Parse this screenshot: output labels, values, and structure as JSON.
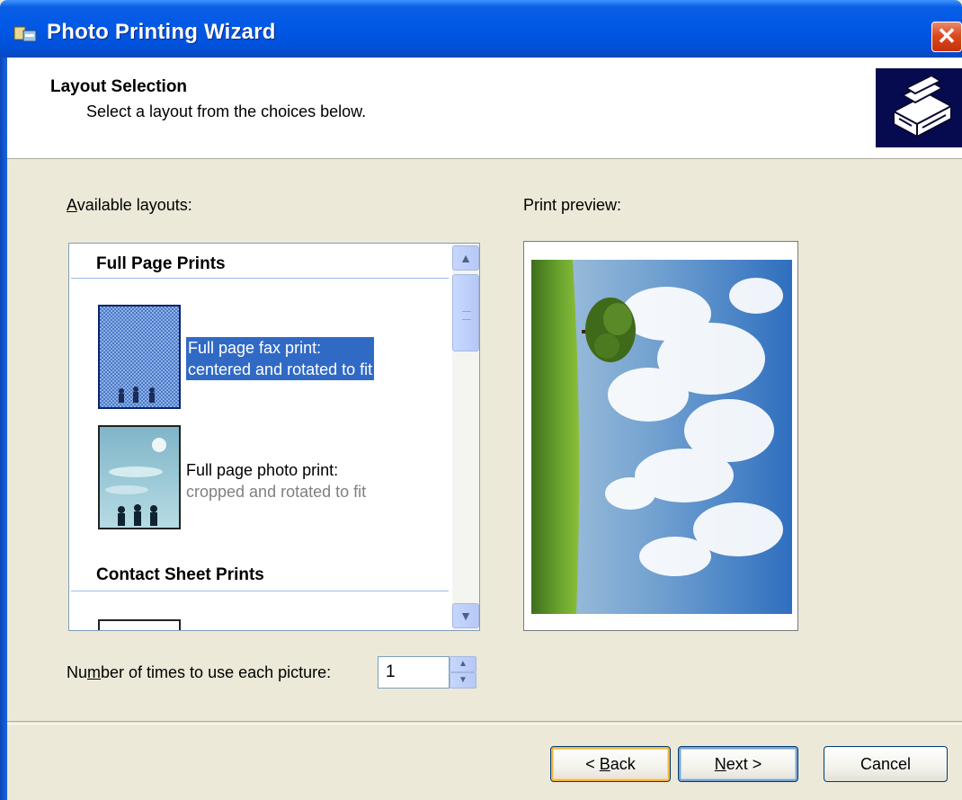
{
  "window": {
    "title": "Photo Printing Wizard",
    "close_label": "✕"
  },
  "header": {
    "title": "Layout Selection",
    "subtitle": "Select a layout from the choices below."
  },
  "layouts": {
    "label_prefix": "",
    "label_accel": "A",
    "label_rest": "vailable layouts:",
    "groups": [
      {
        "title": "Full Page Prints"
      },
      {
        "title": "Contact Sheet Prints"
      }
    ],
    "items": [
      {
        "line1": "Full page fax print:",
        "line2": "centered and rotated to fit",
        "selected": true
      },
      {
        "line1": "Full page photo print:",
        "line2": "cropped and rotated to fit",
        "selected": false
      }
    ]
  },
  "preview": {
    "label": "Print preview:"
  },
  "copies": {
    "label_pre": "Nu",
    "label_accel": "m",
    "label_rest": "ber of times to use each picture:",
    "value": "1"
  },
  "buttons": {
    "back_pre": "< ",
    "back_accel": "B",
    "back_rest": "ack",
    "next_accel": "N",
    "next_rest": "ext >",
    "cancel": "Cancel"
  },
  "colors": {
    "titlebar": "#0058e4",
    "selection": "#316ac5",
    "dialog_bg": "#ece9d8"
  }
}
